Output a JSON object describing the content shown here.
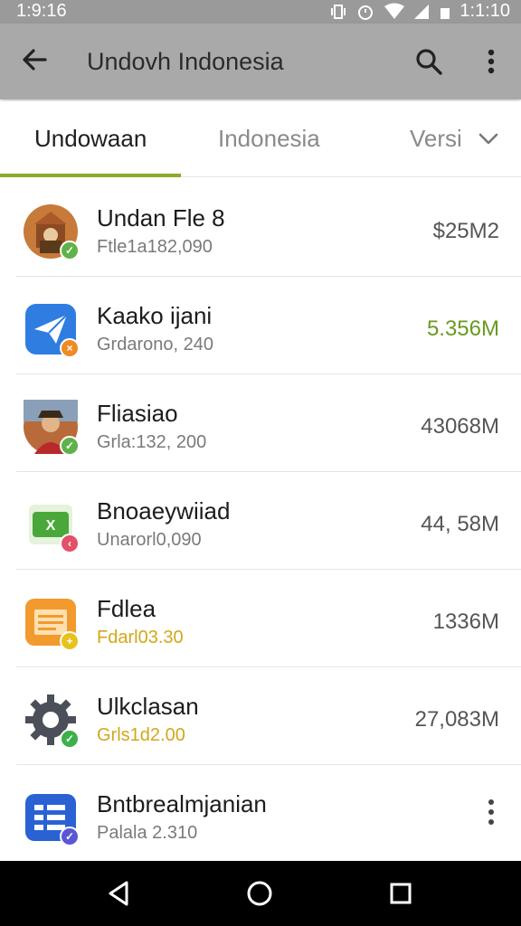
{
  "status_bar": {
    "time": "1:9:16",
    "clock_right": "1:1:10"
  },
  "app_bar": {
    "title": "Undovh Indonesia"
  },
  "tabs": [
    {
      "label": "Undowaan"
    },
    {
      "label": "Indonesia"
    },
    {
      "label": "Versi"
    }
  ],
  "apps": [
    {
      "name": "Undan Fle 8",
      "sub": "Ftle1a182,090",
      "size": "$25M2",
      "size_color": "#555555",
      "sub_color": "#7a7a7a",
      "badge_color": "#5fb24a"
    },
    {
      "name": "Kaako ijani",
      "sub": "Grdarono, 240",
      "size": "5.356M",
      "size_color": "#6a9a1e",
      "sub_color": "#7a7a7a",
      "badge_color": "#f08a24"
    },
    {
      "name": "Fliasiao",
      "sub": "Grla:132, 200",
      "size": "43068M",
      "size_color": "#555555",
      "sub_color": "#7a7a7a",
      "badge_color": "#5fb24a"
    },
    {
      "name": "Bnoaeywiiad",
      "sub": "Unarorl0,090",
      "size": "44, 58M",
      "size_color": "#555555",
      "sub_color": "#7a7a7a",
      "badge_color": "#e2506a"
    },
    {
      "name": "Fdlea",
      "sub": "Fdarl03.30",
      "size": "1336M",
      "size_color": "#555555",
      "sub_color": "#d4a61a",
      "badge_color": "#e8c21c"
    },
    {
      "name": "Ulkclasan",
      "sub": "Grls1d2.00",
      "size": "27,083M",
      "size_color": "#555555",
      "sub_color": "#d4a61a",
      "badge_color": "#3cb04a"
    },
    {
      "name": "Bntbrealmjanian",
      "sub": "Palala 2.310",
      "size": "",
      "size_color": "#555555",
      "sub_color": "#7a7a7a",
      "badge_color": "#5b56d6"
    }
  ],
  "colors": {
    "accent": "#8bab2a",
    "app_bar": "#a9a9a9",
    "status_bar": "#9a9a9a"
  }
}
